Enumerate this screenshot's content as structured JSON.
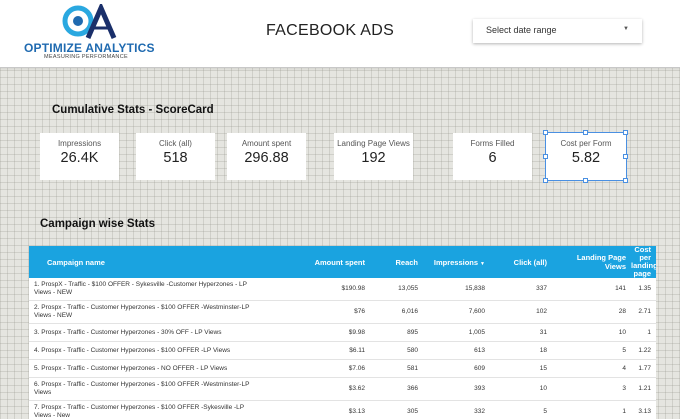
{
  "header": {
    "logo_text": "OPTIMIZE ANALYTICS",
    "logo_sub": "MEASURING PERFORMANCE",
    "title": "FACEBOOK ADS",
    "date_placeholder": "Select date range"
  },
  "scorecard": {
    "title": "Cumulative Stats - ScoreCard",
    "cards": [
      {
        "label": "Impressions",
        "value": "26.4K"
      },
      {
        "label": "Click (all)",
        "value": "518"
      },
      {
        "label": "Amount spent",
        "value": "296.88"
      },
      {
        "label": "Landing Page Views",
        "value": "192"
      },
      {
        "label": "Forms Filled",
        "value": "6"
      },
      {
        "label": "Cost per Form",
        "value": "5.82"
      }
    ]
  },
  "campaign": {
    "title": "Campaign wise Stats",
    "columns": [
      "Campaign name",
      "Amount spent",
      "Reach",
      "Impressions",
      "Click (all)",
      "Landing Page Views",
      "Cost per landing page"
    ],
    "rows": [
      {
        "idx": "1.",
        "name": "ProspX - Traffic - $100 OFFER - Sykesville -Customer Hyperzones - LP Views - NEW",
        "spent": "$190.98",
        "reach": "13,055",
        "impr": "15,838",
        "clicks": "337",
        "lpv": "141",
        "cplp": "1.35"
      },
      {
        "idx": "2.",
        "name": "Prospx - Traffic - Customer Hyperzones - $100 OFFER -Westminster-LP Views - NEW",
        "spent": "$76",
        "reach": "6,016",
        "impr": "7,600",
        "clicks": "102",
        "lpv": "28",
        "cplp": "2.71"
      },
      {
        "idx": "3.",
        "name": "Prospx - Traffic - Customer Hyperzones - 30% OFF - LP Views",
        "spent": "$9.98",
        "reach": "895",
        "impr": "1,005",
        "clicks": "31",
        "lpv": "10",
        "cplp": "1"
      },
      {
        "idx": "4.",
        "name": "Prospx - Traffic - Customer Hyperzones - $100 OFFER -LP Views",
        "spent": "$6.11",
        "reach": "580",
        "impr": "613",
        "clicks": "18",
        "lpv": "5",
        "cplp": "1.22"
      },
      {
        "idx": "5.",
        "name": "Prospx - Traffic - Customer Hyperzones - NO OFFER - LP Views",
        "spent": "$7.06",
        "reach": "581",
        "impr": "609",
        "clicks": "15",
        "lpv": "4",
        "cplp": "1.77"
      },
      {
        "idx": "6.",
        "name": "Prospx - Traffic - Customer Hyperzones - $100 OFFER -Westminster-LP Views",
        "spent": "$3.62",
        "reach": "366",
        "impr": "393",
        "clicks": "10",
        "lpv": "3",
        "cplp": "1.21"
      },
      {
        "idx": "7.",
        "name": "Prospx - Traffic - Customer Hyperzones - $100 OFFER -Sykesville -LP Views - New",
        "spent": "$3.13",
        "reach": "305",
        "impr": "332",
        "clicks": "5",
        "lpv": "1",
        "cplp": "3.13"
      }
    ]
  },
  "colors": {
    "table_header": "#1aa3e0",
    "logo_blue": "#1f6ab0",
    "selection": "#4a90e2"
  }
}
